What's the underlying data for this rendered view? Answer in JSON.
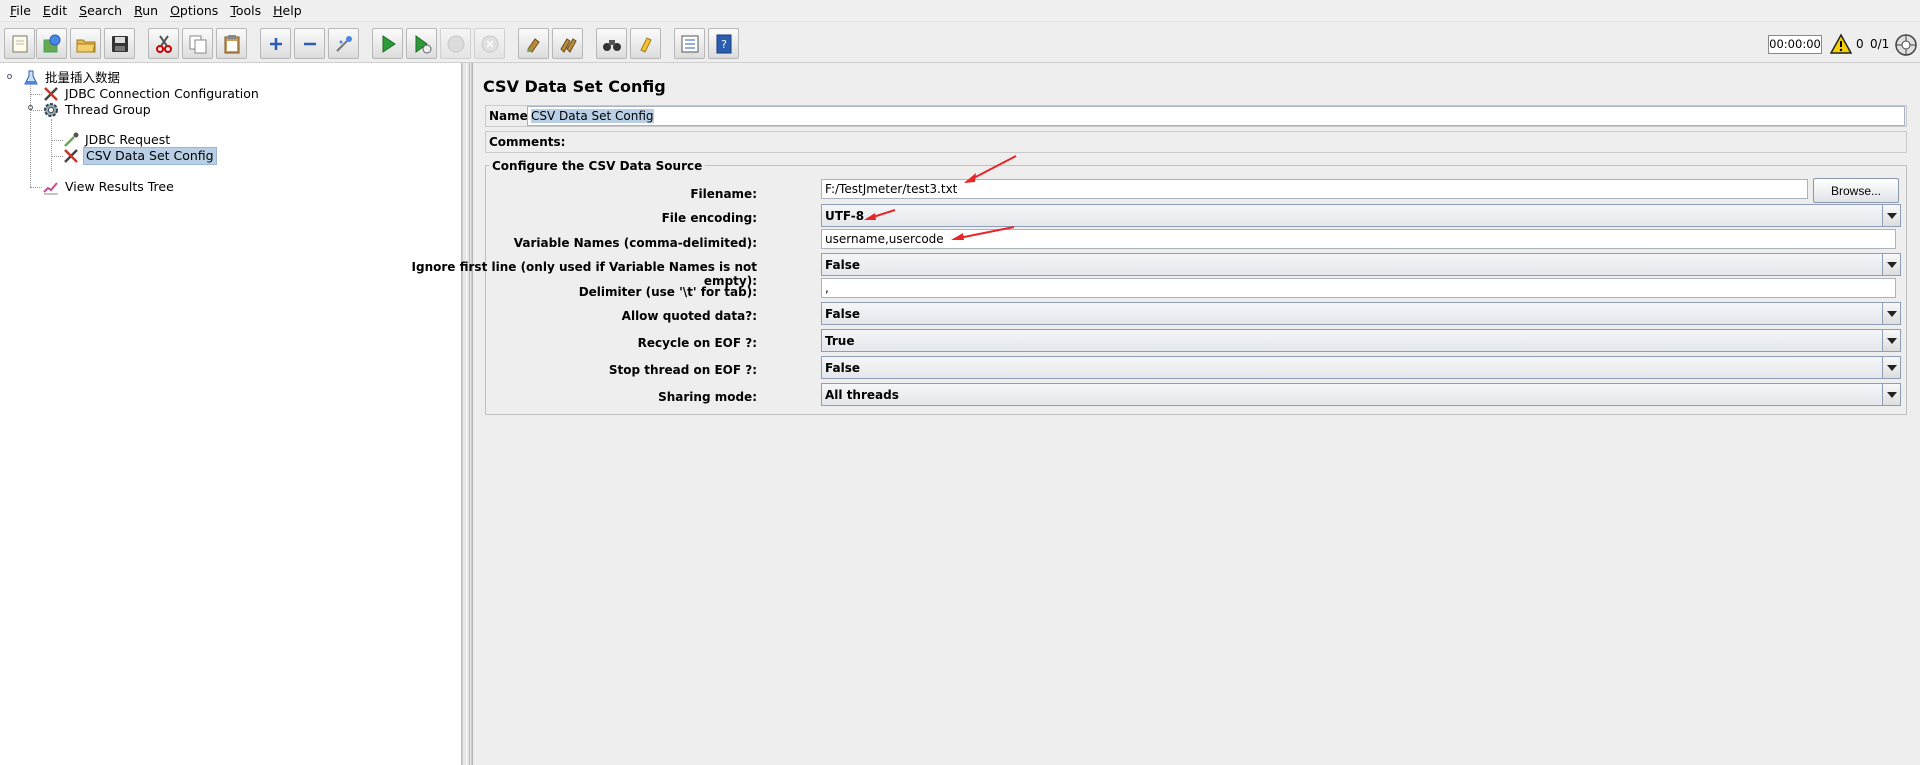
{
  "menu": [
    {
      "pre": "",
      "ul": "F",
      "post": "ile"
    },
    {
      "pre": "",
      "ul": "E",
      "post": "dit"
    },
    {
      "pre": "",
      "ul": "S",
      "post": "earch"
    },
    {
      "pre": "",
      "ul": "R",
      "post": "un"
    },
    {
      "pre": "",
      "ul": "O",
      "post": "ptions"
    },
    {
      "pre": "",
      "ul": "T",
      "post": "ools"
    },
    {
      "pre": "",
      "ul": "H",
      "post": "elp"
    }
  ],
  "status": {
    "timer": "00:00:00",
    "error_count": "0",
    "threads": "0/1"
  },
  "tree": {
    "root": "批量插入数据",
    "jdbc_connection": "JDBC Connection Configuration",
    "thread_group": "Thread Group",
    "jdbc_request": "JDBC Request",
    "csv_config": "CSV Data Set Config",
    "view_results": "View Results Tree"
  },
  "panel": {
    "title": "CSV Data Set Config",
    "name_label": "Name:",
    "name_value": "CSV Data Set Config",
    "comments_label": "Comments:",
    "group_title": "Configure the CSV Data Source"
  },
  "fields": {
    "filename": {
      "label": "Filename:",
      "value": "F:/TestJmeter/test3.txt"
    },
    "browse": "Browse...",
    "encoding": {
      "label": "File encoding:",
      "value": "UTF-8"
    },
    "variables": {
      "label": "Variable Names (comma-delimited):",
      "value": "username,usercode"
    },
    "ignore_first": {
      "label": "Ignore first line (only used if Variable Names is not empty):",
      "value": "False"
    },
    "delimiter": {
      "label": "Delimiter (use '\\t' for tab):",
      "value": ","
    },
    "quoted": {
      "label": "Allow quoted data?:",
      "value": "False"
    },
    "recycle": {
      "label": "Recycle on EOF ?:",
      "value": "True"
    },
    "stop_thread": {
      "label": "Stop thread on EOF ?:",
      "value": "False"
    },
    "sharing": {
      "label": "Sharing mode:",
      "value": "All threads"
    }
  },
  "colors": {
    "annotation_arrow": "#e8262a",
    "selection": "#b8cfe5"
  }
}
